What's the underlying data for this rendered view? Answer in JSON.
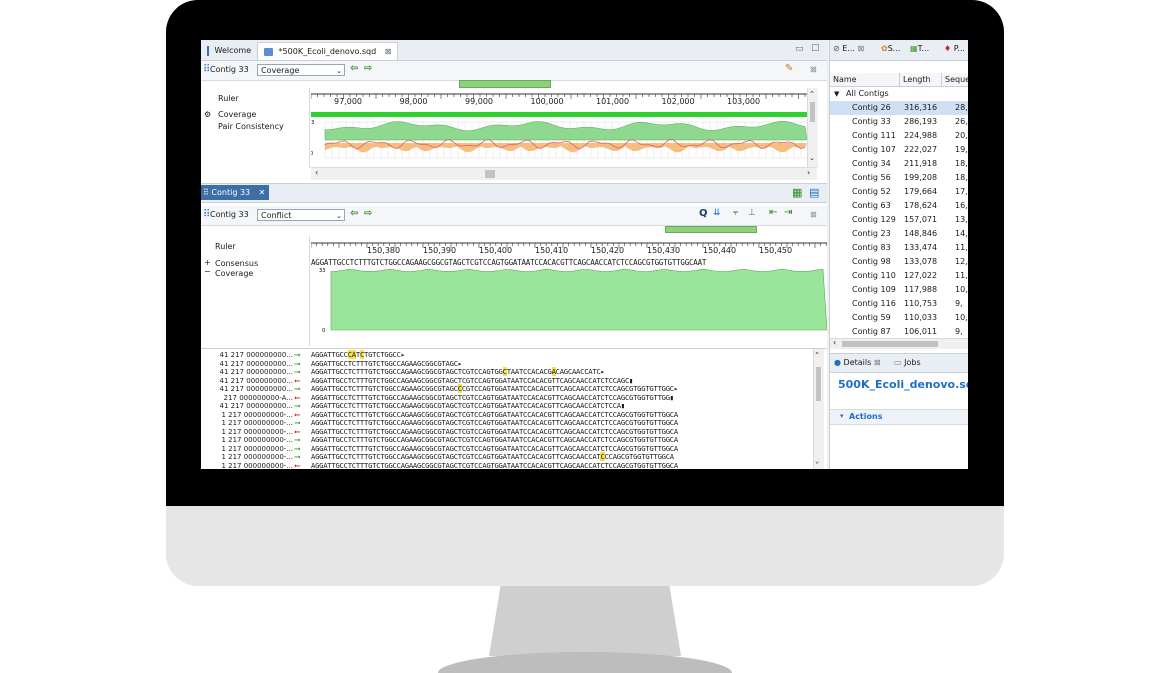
{
  "colors": {
    "accent": "#1f6fc8",
    "coverage_fill": "#8fe28f",
    "consistency_good": "#8fd88f",
    "consistency_orange": "#f4b36a",
    "consistency_red": "#f08a8a",
    "forward_arrow": "#2d9b2d",
    "reverse_arrow": "#d02020",
    "mismatch_highlight": "#f5e04a"
  },
  "editor_tabs": [
    {
      "label": "Welcome",
      "icon": "welcome-icon"
    },
    {
      "label": "*500K_Ecoli_denovo.sqd",
      "icon": "document-icon",
      "close": "⊠"
    }
  ],
  "top_view": {
    "contig_label": "Contig 33",
    "view_mode": "Coverage",
    "tracks": [
      "Ruler",
      "Coverage",
      "Pair Consistency"
    ],
    "ruler_ticks": [
      "97,000",
      "98,000",
      "99,000",
      "100,000",
      "101,000",
      "102,000",
      "103,000"
    ],
    "coverage_axis": [
      "33",
      "0"
    ]
  },
  "contig_tab": {
    "label": "Contig 33",
    "close": "✕"
  },
  "bottom_view": {
    "contig_label": "Contig 33",
    "view_mode": "Conflict",
    "tracks": [
      "Ruler",
      "Consensus",
      "Coverage"
    ],
    "ruler_ticks": [
      "150,380",
      "150,390",
      "150,400",
      "150,410",
      "150,420",
      "150,430",
      "150,440",
      "150,450"
    ],
    "consensus": "AGGATTGCCTCTTTGTCTGGCCAGAAGCGGCGTAGCTCGTCCAGTGGATAATCCACACGTTCAGCAACCATCTCCAGCGTGGTGTTGGCAAT",
    "coverage_axis": [
      "33",
      "0"
    ]
  },
  "reads": [
    {
      "label": "41 217 000000000...",
      "dir": "⟶",
      "strand": "f",
      "parts": [
        [
          "AGGATTGCC",
          ""
        ],
        [
          "CA",
          "hl"
        ],
        [
          "T",
          ""
        ],
        [
          "C",
          "hl"
        ],
        [
          "TGTCTGGCC▸",
          ""
        ]
      ]
    },
    {
      "label": "41 217 000000000...",
      "dir": "⟶",
      "strand": "f",
      "parts": [
        [
          "AGGATTGCCTCTTTGTCTGGCCAGAAGCGGCGTAGC▸",
          ""
        ]
      ]
    },
    {
      "label": "41 217 000000000...",
      "dir": "⟶",
      "strand": "f",
      "parts": [
        [
          "AGGATTGCCTCTTTGTCTGGCCAGAAGCGGCGTAGCTCGTCCAGTGG",
          ""
        ],
        [
          "C",
          "hl"
        ],
        [
          "TAATCCACACG",
          ""
        ],
        [
          "A",
          "hl"
        ],
        [
          "CAGCAACCATC▸",
          ""
        ]
      ]
    },
    {
      "label": "41 217 000000000...",
      "dir": "⟵",
      "strand": "r",
      "parts": [
        [
          "AGGATTGCCTCTTTGTCTGGCCAGAAGCGGCGTAGCTCGTCCAGTGGATAATCCACACGTTCAGCAACCATCTCCAGC▮",
          ""
        ]
      ]
    },
    {
      "label": "41 217 000000000...",
      "dir": "⟶",
      "strand": "f",
      "parts": [
        [
          "AGGATTGCCTCTTTGTCTGGCCAGAAGCGGCGTAGC",
          ""
        ],
        [
          "C",
          "hl"
        ],
        [
          "CGTCCAGTGGATAATCCACACGTTCAGCAACCATCTCCAGCGTGGTGTTGGC▸",
          ""
        ]
      ]
    },
    {
      "label": "217 000000000-A...",
      "dir": "⟵",
      "strand": "r",
      "parts": [
        [
          "AGGATTGCCTCTTTGTCTGGCCAGAAGCGGCGTAGCTCGTCCAGTGGATAATCCACACGTTCAGCAACCATCTCCAGCGTGGTGTTGG▮",
          ""
        ]
      ]
    },
    {
      "label": "41 217 000000000...",
      "dir": "⟶",
      "strand": "f",
      "parts": [
        [
          "AGGATTGCCTCTTTGTCTGGCCAGAAGCGGCGTAGCTCGTCCAGTGGATAATCCACACGTTCAGCAACCATCTCCA▮",
          ""
        ]
      ]
    },
    {
      "label": "1 217 000000000-...",
      "dir": "⟵",
      "strand": "r",
      "parts": [
        [
          "AGGATTGCCTCTTTGTCTGGCCAGAAGCGGCGTAGCTCGTCCAGTGGATAATCCACACGTTCAGCAACCATCTCCAGCGTGGTGTTGGCA",
          ""
        ]
      ]
    },
    {
      "label": "1 217 000000000-...",
      "dir": "⟶",
      "strand": "f",
      "parts": [
        [
          "AGGATTGCCTCTTTGTCTGGCCAGAAGCGGCGTAGCTCGTCCAGTGGATAATCCACACGTTCAGCAACCATCTCCAGCGTGGTGTTGGCA",
          ""
        ]
      ]
    },
    {
      "label": "1 217 000000000-...",
      "dir": "⟵",
      "strand": "r",
      "parts": [
        [
          "AGGATTGCCTCTTTGTCTGGCCAGAAGCGGCGTAGCTCGTCCAGTGGATAATCCACACGTTCAGCAACCATCTCCAGCGTGGTGTTGGCA",
          ""
        ]
      ]
    },
    {
      "label": "1 217 000000000-...",
      "dir": "⟶",
      "strand": "f",
      "parts": [
        [
          "AGGATTGCCTCTTTGTCTGGCCAGAAGCGGCGTAGCTCGTCCAGTGGATAATCCACACGTTCAGCAACCATCTCCAGCGTGGTGTTGGCA",
          ""
        ]
      ]
    },
    {
      "label": "1 217 000000000-...",
      "dir": "⟶",
      "strand": "f",
      "parts": [
        [
          "AGGATTGCCTCTTTGTCTGGCCAGAAGCGGCGTAGCTCGTCCAGTGGATAATCCACACGTTCAGCAACCATCTCCAGCGTGGTGTTGGCA",
          ""
        ]
      ]
    },
    {
      "label": "1 217 000000000-...",
      "dir": "⟶",
      "strand": "f",
      "parts": [
        [
          "AGGATTGCCTCTTTGTCTGGCCAGAAGCGGCGTAGCTCGTCCAGTGGATAATCCACACGTTCAGCAACCAT",
          ""
        ],
        [
          "C",
          "hl"
        ],
        [
          "CCAGCGTGGTGTTGGCA",
          ""
        ]
      ]
    },
    {
      "label": "1 217 000000000-...",
      "dir": "⟵",
      "strand": "r",
      "parts": [
        [
          "AGGATTGCCTCTTTGTCTGGCCAGAAGCGGCGTAGCTCGTCCAGTGGATAATCCACACGTTCAGCAACCATCTCCAGCGTGGTGTTGGCA",
          ""
        ]
      ]
    },
    {
      "label": "41 217 000000000...",
      "dir": "⟶",
      "strand": "f",
      "parts": [
        [
          "AGGATTGCCTCTTTGTCTGGCCAGAAGCGGCGTAGCTCGTCCAGTGGATAATCCACACGTTCAGCAACCATCTCCAGCGTGGTGTTGGCA",
          ""
        ]
      ]
    }
  ],
  "right_panel": {
    "tabs": [
      "E...",
      "S...",
      "T...",
      "P..."
    ],
    "columns": [
      "Name",
      "Length",
      "Seque"
    ],
    "group": "All Contigs",
    "contigs": [
      {
        "name": "Contig 26",
        "length": "316,316",
        "seq": "28,"
      },
      {
        "name": "Contig 33",
        "length": "286,193",
        "seq": "26,"
      },
      {
        "name": "Contig 111",
        "length": "224,988",
        "seq": "20,"
      },
      {
        "name": "Contig 107",
        "length": "222,027",
        "seq": "19,"
      },
      {
        "name": "Contig 34",
        "length": "211,918",
        "seq": "18,"
      },
      {
        "name": "Contig 56",
        "length": "199,208",
        "seq": "18,"
      },
      {
        "name": "Contig 52",
        "length": "179,664",
        "seq": "17,"
      },
      {
        "name": "Contig 63",
        "length": "178,624",
        "seq": "16,"
      },
      {
        "name": "Contig 129",
        "length": "157,071",
        "seq": "13,"
      },
      {
        "name": "Contig 23",
        "length": "148,846",
        "seq": "14,"
      },
      {
        "name": "Contig 83",
        "length": "133,474",
        "seq": "11,"
      },
      {
        "name": "Contig 98",
        "length": "133,078",
        "seq": "12,"
      },
      {
        "name": "Contig 110",
        "length": "127,022",
        "seq": "11,"
      },
      {
        "name": "Contig 109",
        "length": "117,988",
        "seq": "10,"
      },
      {
        "name": "Contig 116",
        "length": "110,753",
        "seq": "9,"
      },
      {
        "name": "Contig 59",
        "length": "110,033",
        "seq": "10,"
      },
      {
        "name": "Contig 87",
        "length": "106,011",
        "seq": "9,"
      }
    ],
    "details_tab": "Details",
    "jobs_tab": "Jobs",
    "file_title": "500K_Ecoli_denovo.sqd",
    "actions_label": "Actions"
  }
}
